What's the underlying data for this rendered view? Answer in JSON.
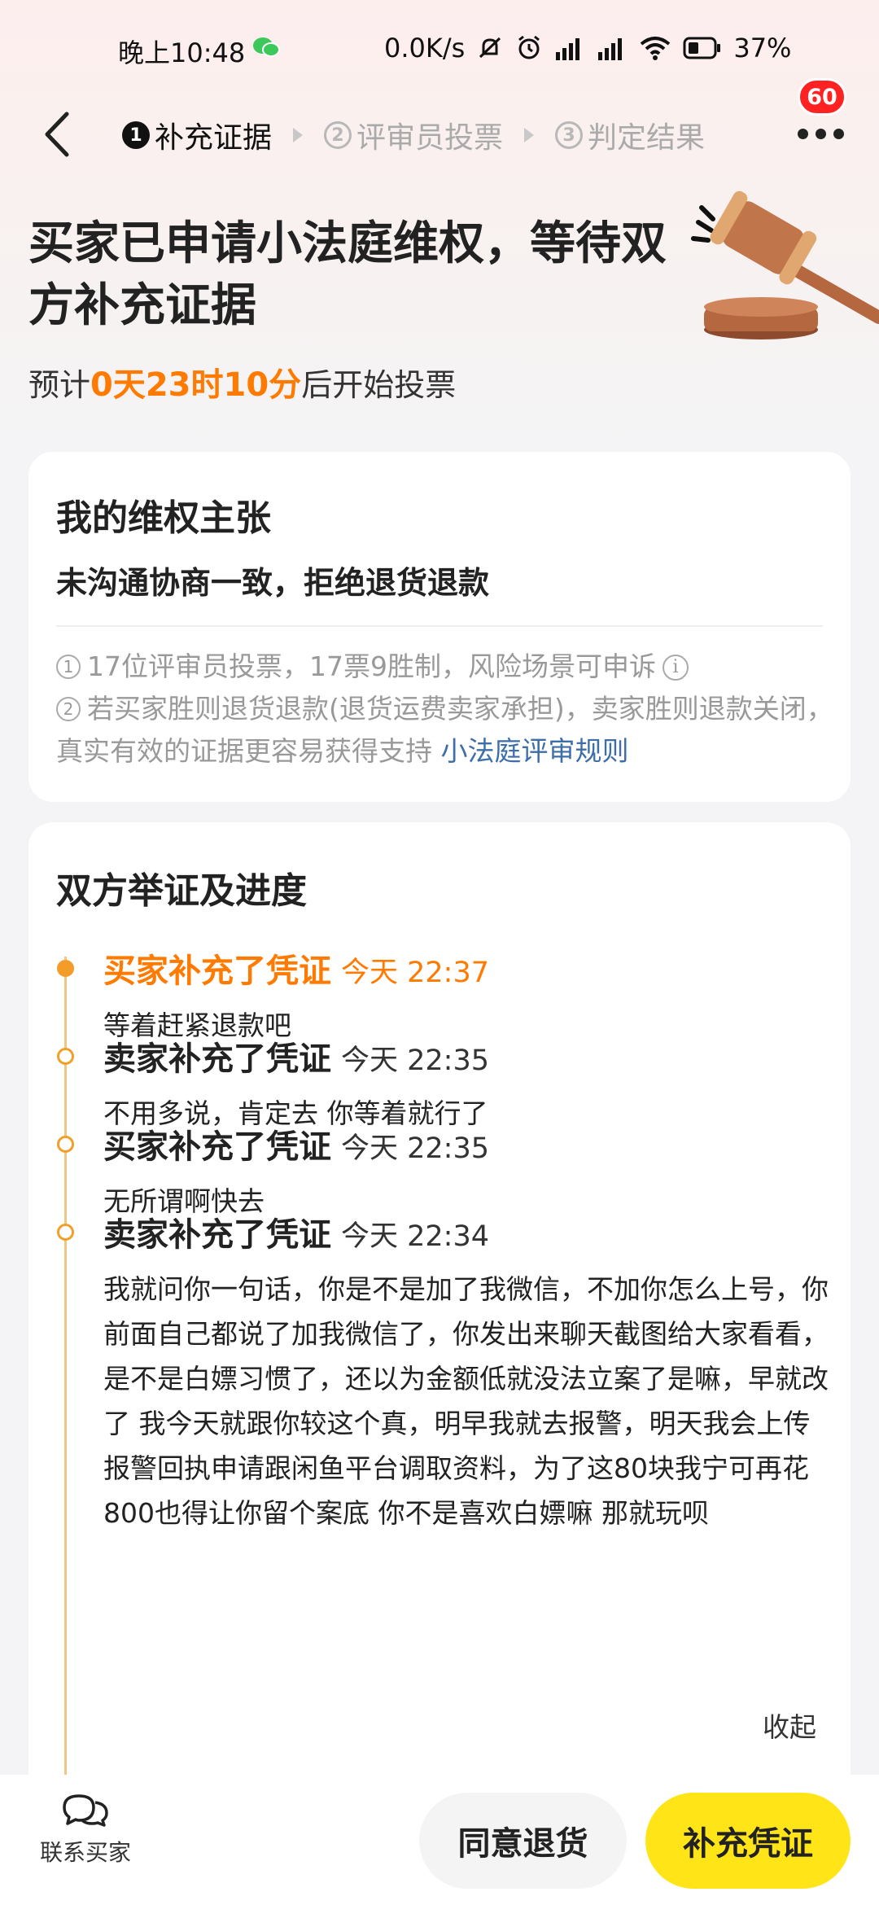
{
  "status_bar": {
    "time": "晚上10:48",
    "network_speed": "0.0K/s",
    "battery": "37%"
  },
  "nav": {
    "steps": [
      {
        "num": "1",
        "label": "补充证据",
        "active": true
      },
      {
        "num": "2",
        "label": "评审员投票",
        "active": false
      },
      {
        "num": "3",
        "label": "判定结果",
        "active": false
      }
    ],
    "badge_count": "60"
  },
  "hero": {
    "title": "买家已申请小法庭维权，等待双方补充证据",
    "eta_prefix": "预计",
    "eta_value": "0天23时10分",
    "eta_suffix": "后开始投票"
  },
  "claim_card": {
    "heading": "我的维权主张",
    "claim": "未沟通协商一致，拒绝退货退款",
    "rule1": "17位评审员投票，17票9胜制，风险场景可申诉",
    "rule2": "若买家胜则退货退款(退货运费卖家承担)，卖家胜则退款关闭，真实有效的证据更容易获得支持",
    "rule_link": "小法庭评审规则"
  },
  "progress_card": {
    "heading": "双方举证及进度",
    "events": [
      {
        "title": "买家补充了凭证",
        "time": "今天 22:37",
        "text": "等着赶紧退款吧"
      },
      {
        "title": "卖家补充了凭证",
        "time": "今天 22:35",
        "text": "不用多说，肯定去 你等着就行了"
      },
      {
        "title": "买家补充了凭证",
        "time": "今天 22:35",
        "text": "无所谓啊快去"
      },
      {
        "title": "卖家补充了凭证",
        "time": "今天 22:34",
        "text": "我就问你一句话，你是不是加了我微信，不加你怎么上号，你前面自己都说了加我微信了，你发出来聊天截图给大家看看，是不是白嫖习惯了，还以为金额低就没法立案了是嘛，早就改了 我今天就跟你较这个真，明早我就去报警，明天我会上传报警回执申请跟闲鱼平台调取资料，为了这80块我宁可再花800也得让你留个案底 你不是喜欢白嫖嘛 那就玩呗"
      }
    ],
    "collapse_label": "收起"
  },
  "bottom_bar": {
    "contact_label": "联系买家",
    "agree_label": "同意退货",
    "evidence_label": "补充凭证"
  },
  "colors": {
    "accent_orange": "#ff7a00",
    "primary_button": "#ffe518",
    "badge_red": "#ff2222",
    "link_blue": "#3d6ea8"
  },
  "icons": [
    "back-icon",
    "more-icon",
    "gavel-icon",
    "info-icon",
    "chat-icon",
    "wechat-icon",
    "wifi-icon",
    "signal-icon",
    "battery-icon",
    "alarm-icon",
    "mute-icon"
  ]
}
